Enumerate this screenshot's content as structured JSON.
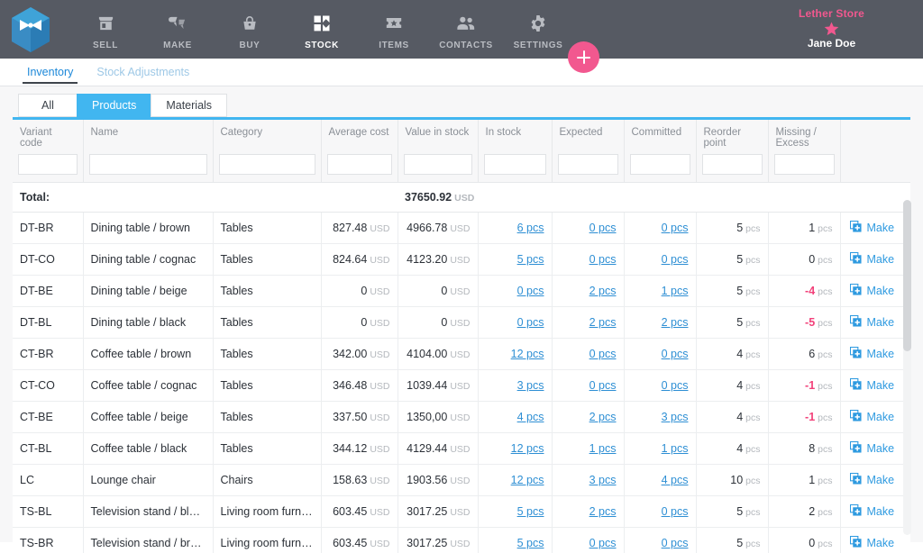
{
  "topnav": {
    "logo_icon": "butterfly-hexagon-logo",
    "items": [
      {
        "label": "SELL",
        "icon": "store-icon",
        "active": false
      },
      {
        "label": "MAKE",
        "icon": "hammer-icon",
        "active": false
      },
      {
        "label": "BUY",
        "icon": "basket-icon",
        "active": false
      },
      {
        "label": "STOCK",
        "icon": "blocks-icon",
        "active": true
      },
      {
        "label": "ITEMS",
        "icon": "ticket-star-icon",
        "active": false
      },
      {
        "label": "CONTACTS",
        "icon": "people-icon",
        "active": false
      },
      {
        "label": "SETTINGS",
        "icon": "gear-icon",
        "active": false
      }
    ],
    "add_button_icon": "plus-icon",
    "store_name": "Lether Store",
    "user_name": "Jane Doe",
    "star_icon": "star-icon",
    "accent_pink": "#f2588f",
    "bar_color": "#565a63"
  },
  "subtabs": [
    {
      "label": "Inventory",
      "active": true
    },
    {
      "label": "Stock Adjustments",
      "active": false
    }
  ],
  "segments": [
    {
      "label": "All",
      "active": false
    },
    {
      "label": "Products",
      "active": true
    },
    {
      "label": "Materials",
      "active": false
    }
  ],
  "table": {
    "columns": [
      "Variant code",
      "Name",
      "Category",
      "Average cost",
      "Value in stock",
      "In stock",
      "Expected",
      "Committed",
      "Reorder point",
      "Missing / Excess",
      ""
    ],
    "filter_placeholder": "",
    "total": {
      "label": "Total:",
      "value_in_stock": "37650.92",
      "currency": "USD"
    },
    "unit_currency": "USD",
    "unit_pieces": "pcs",
    "make_label": "Make",
    "make_icon": "copy-plus-icon",
    "rows": [
      {
        "code": "DT-BR",
        "name": "Dining table / brown",
        "category": "Tables",
        "avg_cost": "827.48",
        "value_in_stock": "4966.78",
        "in_stock": "6",
        "expected": "0",
        "committed": "0",
        "reorder_point": "5",
        "missing_excess": "1",
        "negative": false
      },
      {
        "code": "DT-CO",
        "name": "Dining table / cognac",
        "category": "Tables",
        "avg_cost": "824.64",
        "value_in_stock": "4123.20",
        "in_stock": "5",
        "expected": "0",
        "committed": "0",
        "reorder_point": "5",
        "missing_excess": "0",
        "negative": false
      },
      {
        "code": "DT-BE",
        "name": "Dining table / beige",
        "category": "Tables",
        "avg_cost": "0",
        "value_in_stock": "0",
        "in_stock": "0",
        "expected": "2",
        "committed": "1",
        "reorder_point": "5",
        "missing_excess": "-4",
        "negative": true
      },
      {
        "code": "DT-BL",
        "name": "Dining table / black",
        "category": "Tables",
        "avg_cost": "0",
        "value_in_stock": "0",
        "in_stock": "0",
        "expected": "2",
        "committed": "2",
        "reorder_point": "5",
        "missing_excess": "-5",
        "negative": true
      },
      {
        "code": "CT-BR",
        "name": "Coffee table / brown",
        "category": "Tables",
        "avg_cost": "342.00",
        "value_in_stock": "4104.00",
        "in_stock": "12",
        "expected": "0",
        "committed": "0",
        "reorder_point": "4",
        "missing_excess": "6",
        "negative": false
      },
      {
        "code": "CT-CO",
        "name": "Coffee table / cognac",
        "category": "Tables",
        "avg_cost": "346.48",
        "value_in_stock": "1039.44",
        "in_stock": "3",
        "expected": "0",
        "committed": "0",
        "reorder_point": "4",
        "missing_excess": "-1",
        "negative": true
      },
      {
        "code": "CT-BE",
        "name": "Coffee table / beige",
        "category": "Tables",
        "avg_cost": "337.50",
        "value_in_stock": "1350,00",
        "in_stock": "4",
        "expected": "2",
        "committed": "3",
        "reorder_point": "4",
        "missing_excess": "-1",
        "negative": true
      },
      {
        "code": "CT-BL",
        "name": "Coffee table / black",
        "category": "Tables",
        "avg_cost": "344.12",
        "value_in_stock": "4129.44",
        "in_stock": "12",
        "expected": "1",
        "committed": "1",
        "reorder_point": "4",
        "missing_excess": "8",
        "negative": false
      },
      {
        "code": "LC",
        "name": "Lounge chair",
        "category": "Chairs",
        "avg_cost": "158.63",
        "value_in_stock": "1903.56",
        "in_stock": "12",
        "expected": "3",
        "committed": "4",
        "reorder_point": "10",
        "missing_excess": "1",
        "negative": false
      },
      {
        "code": "TS-BL",
        "name": "Television stand / black...",
        "category": "Living room furniture",
        "avg_cost": "603.45",
        "value_in_stock": "3017.25",
        "in_stock": "5",
        "expected": "2",
        "committed": "0",
        "reorder_point": "5",
        "missing_excess": "2",
        "negative": false
      },
      {
        "code": "TS-BR",
        "name": "Television stand / brown...",
        "category": "Living room furniture",
        "avg_cost": "603.45",
        "value_in_stock": "3017.25",
        "in_stock": "5",
        "expected": "0",
        "committed": "0",
        "reorder_point": "5",
        "missing_excess": "0",
        "negative": false
      }
    ]
  }
}
